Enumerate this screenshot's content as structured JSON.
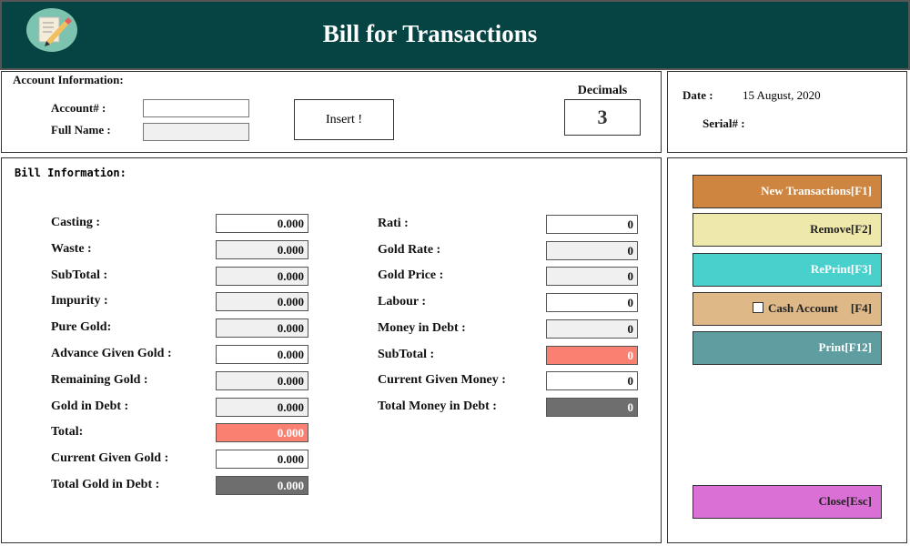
{
  "header": {
    "title": "Bill for Transactions",
    "logo_icon": "notepad-pencil-icon"
  },
  "account": {
    "heading": "Account Information:",
    "account_label": "Account# :",
    "account_value": "",
    "fullname_label": "Full Name :",
    "fullname_value": "",
    "insert_label": "Insert !",
    "decimals_label": "Decimals",
    "decimals_value": "3"
  },
  "info": {
    "date_label": "Date :",
    "date_value": "15 August, 2020",
    "serial_label": "Serial# :",
    "serial_value": ""
  },
  "bill": {
    "heading": "Bill Information:",
    "left": [
      {
        "label": "Casting :",
        "value": "0.000",
        "style": "white"
      },
      {
        "label": "Waste :",
        "value": "0.000",
        "style": "grey"
      },
      {
        "label": "SubTotal :",
        "value": "0.000",
        "style": "grey"
      },
      {
        "label": "Impurity :",
        "value": "0.000",
        "style": "grey"
      },
      {
        "label": "Pure Gold:",
        "value": "0.000",
        "style": "grey"
      },
      {
        "label": "Advance Given Gold :",
        "value": "0.000",
        "style": "white"
      },
      {
        "label": "Remaining Gold :",
        "value": "0.000",
        "style": "grey"
      },
      {
        "label": "Gold in Debt :",
        "value": "0.000",
        "style": "grey"
      },
      {
        "label": "Total:",
        "value": "0.000",
        "style": "salmon"
      },
      {
        "label": "Current Given Gold :",
        "value": "0.000",
        "style": "white"
      },
      {
        "label": "Total Gold in Debt :",
        "value": "0.000",
        "style": "dark"
      }
    ],
    "right": [
      {
        "label": "Rati :",
        "value": "0",
        "style": "white"
      },
      {
        "label": "Gold Rate :",
        "value": "0",
        "style": "grey"
      },
      {
        "label": "Gold Price :",
        "value": "0",
        "style": "grey"
      },
      {
        "label": "Labour :",
        "value": "0",
        "style": "white"
      },
      {
        "label": "Money in Debt :",
        "value": "0",
        "style": "grey"
      },
      {
        "label": "SubTotal :",
        "value": "0",
        "style": "salmon"
      },
      {
        "label": "Current Given Money :",
        "value": "0",
        "style": "white"
      },
      {
        "label": "Total Money in Debt :",
        "value": "0",
        "style": "dark"
      }
    ]
  },
  "actions": {
    "new": "New Transactions[F1]",
    "remove": "Remove[F2]",
    "reprint": "RePrint[F3]",
    "cash": "Cash Account",
    "cash_key": "[F4]",
    "cash_checked": false,
    "print": "Print[F12]",
    "close": "Close[Esc]"
  },
  "colors": {
    "header": "#054442",
    "new": "#cd853f",
    "remove": "#eee8aa",
    "reprint": "#48d1cc",
    "cash": "#deb887",
    "print": "#5f9ea0",
    "close": "#da70d6",
    "total": "#fa8072",
    "debt": "#6e6e6e"
  }
}
